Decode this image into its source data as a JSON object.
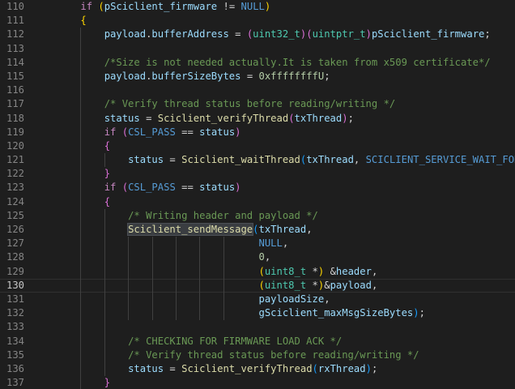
{
  "editor": {
    "active_line": "130",
    "lines": [
      {
        "num": "110",
        "tokens": [
          [
            "    ",
            ""
          ],
          [
            "if",
            "ctl"
          ],
          [
            " ",
            ""
          ],
          [
            "(",
            "br1"
          ],
          [
            "pSciclient_firmware",
            "var"
          ],
          [
            " != ",
            "punc"
          ],
          [
            "NULL",
            "mac"
          ],
          [
            ")",
            "br1"
          ]
        ]
      },
      {
        "num": "111",
        "tokens": [
          [
            "    ",
            ""
          ],
          [
            "{",
            "br1"
          ]
        ]
      },
      {
        "num": "112",
        "tokens": [
          [
            "        ",
            ""
          ],
          [
            "payload",
            "var"
          ],
          [
            ".",
            "punc"
          ],
          [
            "bufferAddress",
            "var"
          ],
          [
            " = ",
            "punc"
          ],
          [
            "(",
            "br2"
          ],
          [
            "uint32_t",
            "type"
          ],
          [
            ")",
            "br2"
          ],
          [
            "(",
            "br2"
          ],
          [
            "uintptr_t",
            "type"
          ],
          [
            ")",
            "br2"
          ],
          [
            "pSciclient_firmware",
            "var"
          ],
          [
            ";",
            "punc"
          ]
        ]
      },
      {
        "num": "113",
        "tokens": []
      },
      {
        "num": "114",
        "tokens": [
          [
            "        ",
            ""
          ],
          [
            "/*Size is not needed actually.It is taken from x509 certificate*/",
            "cmt"
          ]
        ]
      },
      {
        "num": "115",
        "tokens": [
          [
            "        ",
            ""
          ],
          [
            "payload",
            "var"
          ],
          [
            ".",
            "punc"
          ],
          [
            "bufferSizeBytes",
            "var"
          ],
          [
            " = ",
            "punc"
          ],
          [
            "0xffffffffU",
            "num"
          ],
          [
            ";",
            "punc"
          ]
        ]
      },
      {
        "num": "116",
        "tokens": []
      },
      {
        "num": "117",
        "tokens": [
          [
            "        ",
            ""
          ],
          [
            "/* Verify thread status before reading/writing */",
            "cmt"
          ]
        ]
      },
      {
        "num": "118",
        "tokens": [
          [
            "        ",
            ""
          ],
          [
            "status",
            "var"
          ],
          [
            " = ",
            "punc"
          ],
          [
            "Sciclient_verifyThread",
            "fn"
          ],
          [
            "(",
            "br2"
          ],
          [
            "txThread",
            "var"
          ],
          [
            ")",
            "br2"
          ],
          [
            ";",
            "punc"
          ]
        ]
      },
      {
        "num": "119",
        "tokens": [
          [
            "        ",
            ""
          ],
          [
            "if",
            "ctl"
          ],
          [
            " ",
            ""
          ],
          [
            "(",
            "br2"
          ],
          [
            "CSL_PASS",
            "mac"
          ],
          [
            " == ",
            "punc"
          ],
          [
            "status",
            "var"
          ],
          [
            ")",
            "br2"
          ]
        ]
      },
      {
        "num": "120",
        "tokens": [
          [
            "        ",
            ""
          ],
          [
            "{",
            "br2"
          ]
        ]
      },
      {
        "num": "121",
        "tokens": [
          [
            "            ",
            ""
          ],
          [
            "status",
            "var"
          ],
          [
            " = ",
            "punc"
          ],
          [
            "Sciclient_waitThread",
            "fn"
          ],
          [
            "(",
            "br3"
          ],
          [
            "txThread",
            "var"
          ],
          [
            ", ",
            "punc"
          ],
          [
            "SCICLIENT_SERVICE_WAIT_FOREVER",
            "mac"
          ],
          [
            ")",
            "br3"
          ],
          [
            ";",
            "punc"
          ]
        ]
      },
      {
        "num": "122",
        "tokens": [
          [
            "        ",
            ""
          ],
          [
            "}",
            "br2"
          ]
        ]
      },
      {
        "num": "123",
        "tokens": [
          [
            "        ",
            ""
          ],
          [
            "if",
            "ctl"
          ],
          [
            " ",
            ""
          ],
          [
            "(",
            "br2"
          ],
          [
            "CSL_PASS",
            "mac"
          ],
          [
            " == ",
            "punc"
          ],
          [
            "status",
            "var"
          ],
          [
            ")",
            "br2"
          ]
        ]
      },
      {
        "num": "124",
        "tokens": [
          [
            "        ",
            ""
          ],
          [
            "{",
            "br2"
          ]
        ]
      },
      {
        "num": "125",
        "tokens": [
          [
            "            ",
            ""
          ],
          [
            "/* Writing header and payload */",
            "cmt"
          ]
        ]
      },
      {
        "num": "126",
        "tokens": [
          [
            "            ",
            ""
          ],
          [
            "Sciclient_sendMessage",
            "fn hl"
          ],
          [
            "(",
            "br3"
          ],
          [
            "txThread",
            "var"
          ],
          [
            ",",
            "punc"
          ]
        ]
      },
      {
        "num": "127",
        "tokens": [
          [
            "                                  ",
            ""
          ],
          [
            "NULL",
            "mac"
          ],
          [
            ",",
            "punc"
          ]
        ]
      },
      {
        "num": "128",
        "tokens": [
          [
            "                                  ",
            ""
          ],
          [
            "0",
            "num"
          ],
          [
            ",",
            "punc"
          ]
        ]
      },
      {
        "num": "129",
        "tokens": [
          [
            "                                  ",
            ""
          ],
          [
            "(",
            "br1"
          ],
          [
            "uint8_t",
            "type"
          ],
          [
            " *",
            "punc"
          ],
          [
            ")",
            "br1"
          ],
          [
            " ",
            ""
          ],
          [
            "&",
            "punc"
          ],
          [
            "header",
            "var"
          ],
          [
            ",",
            "punc"
          ]
        ]
      },
      {
        "num": "130",
        "tokens": [
          [
            "                                  ",
            ""
          ],
          [
            "(",
            "br1"
          ],
          [
            "uint8_t",
            "type"
          ],
          [
            " *",
            "punc"
          ],
          [
            ")",
            "br1"
          ],
          [
            "&",
            "punc"
          ],
          [
            "payload",
            "var"
          ],
          [
            ",",
            "punc"
          ]
        ]
      },
      {
        "num": "131",
        "tokens": [
          [
            "                                  ",
            ""
          ],
          [
            "payloadSize",
            "var"
          ],
          [
            ",",
            "punc"
          ]
        ]
      },
      {
        "num": "132",
        "tokens": [
          [
            "                                  ",
            ""
          ],
          [
            "gSciclient_maxMsgSizeBytes",
            "var"
          ],
          [
            ")",
            "br3"
          ],
          [
            ";",
            "punc"
          ]
        ]
      },
      {
        "num": "133",
        "tokens": []
      },
      {
        "num": "134",
        "tokens": [
          [
            "            ",
            ""
          ],
          [
            "/* CHECKING FOR FIRMWARE LOAD ACK */",
            "cmt"
          ]
        ]
      },
      {
        "num": "135",
        "tokens": [
          [
            "            ",
            ""
          ],
          [
            "/* Verify thread status before reading/writing */",
            "cmt"
          ]
        ]
      },
      {
        "num": "136",
        "tokens": [
          [
            "            ",
            ""
          ],
          [
            "status",
            "var"
          ],
          [
            " = ",
            "punc"
          ],
          [
            "Sciclient_verifyThread",
            "fn"
          ],
          [
            "(",
            "br3"
          ],
          [
            "rxThread",
            "var"
          ],
          [
            ")",
            "br3"
          ],
          [
            ";",
            "punc"
          ]
        ]
      },
      {
        "num": "137",
        "tokens": [
          [
            "        ",
            ""
          ],
          [
            "}",
            "br2"
          ]
        ]
      }
    ]
  }
}
